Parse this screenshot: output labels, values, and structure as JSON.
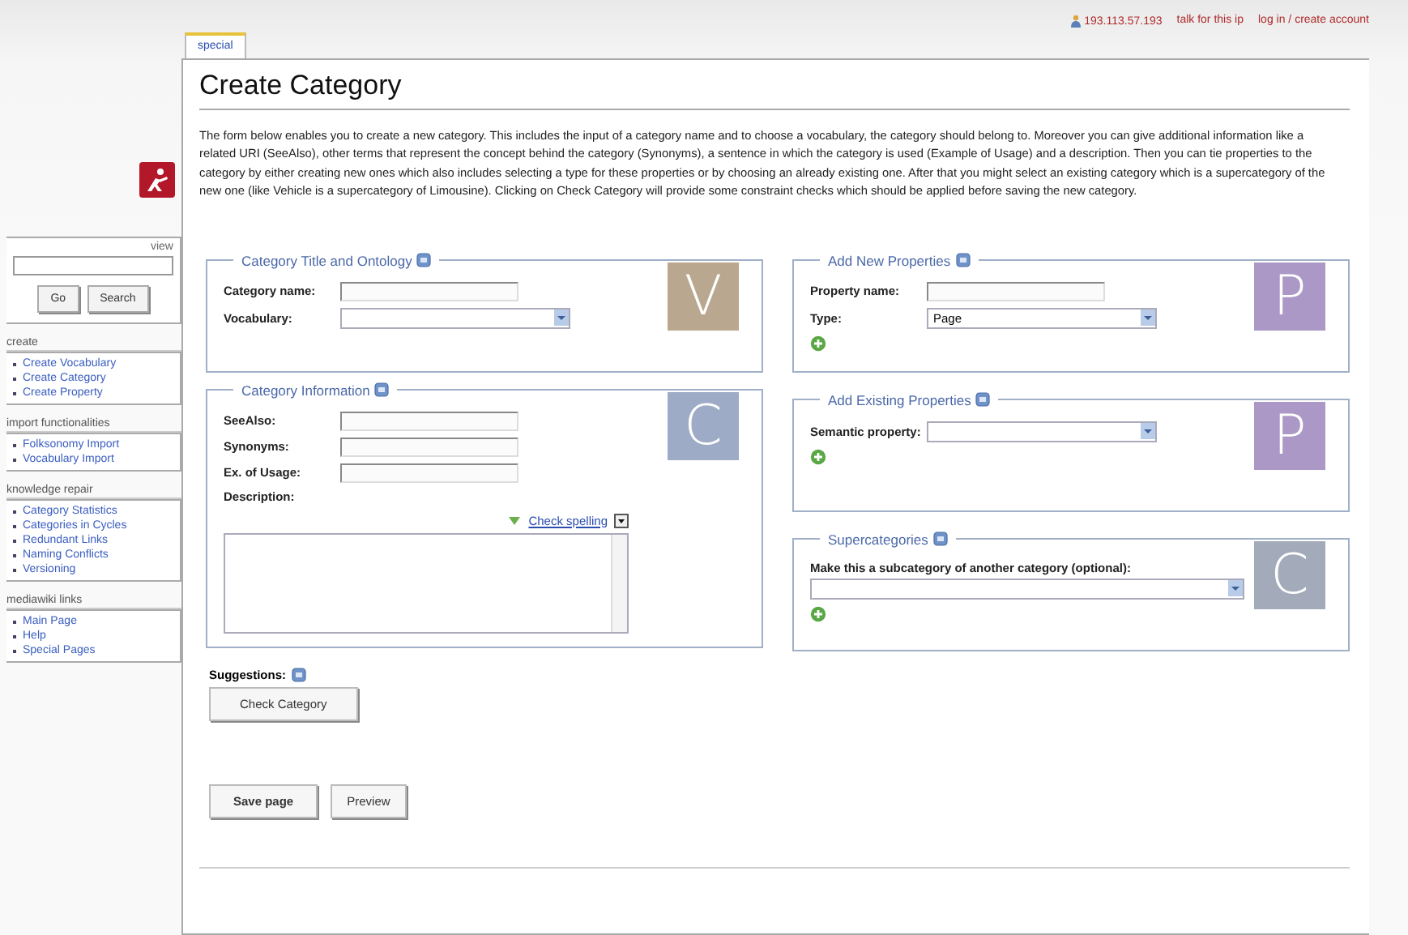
{
  "personal_links": [
    "193.113.57.193",
    "talk for this ip",
    "log in / create account"
  ],
  "sidebar": {
    "search": {
      "label": "view",
      "buttons": [
        "Go",
        "Search"
      ]
    },
    "portlets": [
      {
        "title": "create",
        "items": [
          "Create Vocabulary",
          "Create Category",
          "Create Property"
        ]
      },
      {
        "title": "import functionalities",
        "items": [
          "Folksonomy Import",
          "Vocabulary Import"
        ]
      },
      {
        "title": "knowledge repair",
        "items": [
          "Category Statistics",
          "Categories in Cycles",
          "Redundant Links",
          "Naming Conflicts",
          "Versioning"
        ]
      },
      {
        "title": "mediawiki links",
        "items": [
          "Main Page",
          "Help",
          "Special Pages"
        ]
      }
    ]
  },
  "tabs": [
    {
      "label": "special",
      "selected": true
    }
  ],
  "page": {
    "title": "Create Category",
    "intro": "The form below enables you to create a new category. This includes the input of a category name and to choose a vocabulary, the category should belong to. Moreover you can give additional information like a related URI (SeeAlso), other terms that represent the concept behind the category (Synonyms), a sentence in which the category is used (Example of Usage) and a description. Then you can tie properties to the category by either creating new ones which also includes selecting a type for these properties or by choosing an already existing one. After that you might select an existing category which is a supercategory of the new one (like Vehicle is a supercategory of Limousine). Clicking on Check Category will provide some constraint checks which should be applied before saving the new category."
  },
  "columns": [
    [
      {
        "title": "Category Title and Ontology",
        "badge": "V",
        "color": "#b9a78f",
        "fields": [
          {
            "kind": "text",
            "label": "Category name:"
          },
          {
            "kind": "select",
            "label": "Vocabulary:"
          }
        ]
      },
      {
        "title": "Category Information",
        "badge": "C",
        "color": "#9eabc6",
        "fields": [
          {
            "kind": "text",
            "label": "SeeAlso:"
          },
          {
            "kind": "text",
            "label": "Synonyms:"
          },
          {
            "kind": "text",
            "label": "Ex. of Usage:"
          },
          {
            "kind": "textarea",
            "label": "Description:",
            "link": "Check spelling"
          }
        ]
      }
    ],
    [
      {
        "title": "Add New Properties",
        "badge": "P",
        "color": "#ab98c6",
        "fields": [
          {
            "kind": "text",
            "label": "Property name:"
          },
          {
            "kind": "select",
            "label": "Type:",
            "value": "Page"
          },
          {
            "kind": "add"
          }
        ]
      },
      {
        "title": "Add Existing Properties",
        "badge": "P",
        "color": "#ab98c6",
        "fields": [
          {
            "kind": "select",
            "label": "Semantic property:"
          },
          {
            "kind": "add"
          }
        ]
      },
      {
        "title": "Supercategories",
        "badge": "C",
        "color": "#a3abbb",
        "fields": [
          {
            "kind": "stacked-select",
            "label": "Make this a subcategory of another category (optional):"
          },
          {
            "kind": "add"
          }
        ]
      }
    ]
  ],
  "suggestions": {
    "label": "Suggestions:",
    "button": "Check Category"
  },
  "actions": [
    {
      "label": "Save page",
      "kind": "primary"
    },
    {
      "label": "Preview",
      "kind": "secondary"
    }
  ]
}
